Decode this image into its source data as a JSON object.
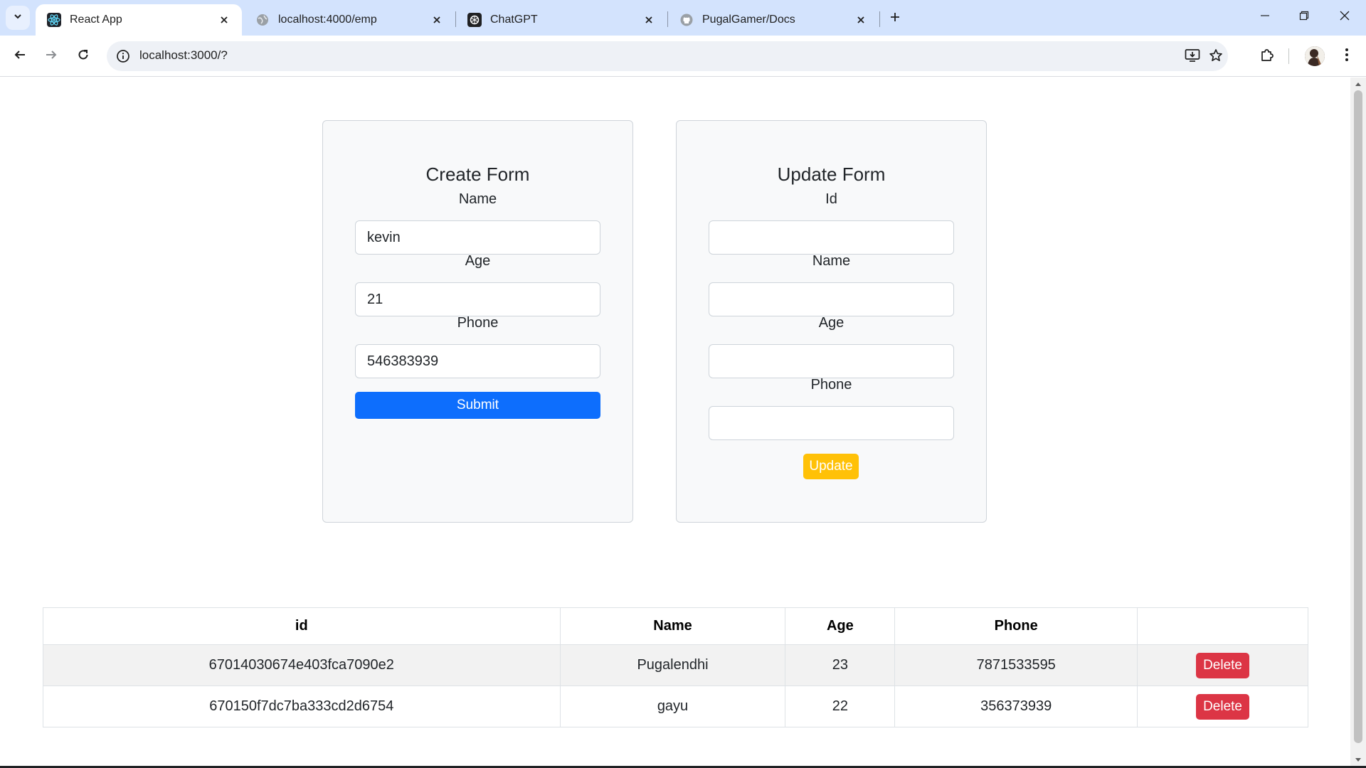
{
  "browser": {
    "tabs": [
      {
        "title": "React App",
        "icon": "react-icon",
        "active": true
      },
      {
        "title": "localhost:4000/emp",
        "icon": "globe-icon",
        "active": false
      },
      {
        "title": "ChatGPT",
        "icon": "chatgpt-icon",
        "active": false
      },
      {
        "title": "PugalGamer/Docs",
        "icon": "github-icon",
        "active": false
      }
    ],
    "url": "localhost:3000/?"
  },
  "create_form": {
    "title": "Create Form",
    "name_label": "Name",
    "name_value": "kevin",
    "age_label": "Age",
    "age_value": "21",
    "phone_label": "Phone",
    "phone_value": "546383939",
    "submit_label": "Submit",
    "submit_color": "#0d6efd"
  },
  "update_form": {
    "title": "Update Form",
    "id_label": "Id",
    "id_value": "",
    "name_label": "Name",
    "name_value": "",
    "age_label": "Age",
    "age_value": "",
    "phone_label": "Phone",
    "phone_value": "",
    "update_label": "Update",
    "update_color": "#ffc107"
  },
  "table": {
    "headers": [
      "id",
      "Name",
      "Age",
      "Phone",
      ""
    ],
    "rows": [
      {
        "id": "67014030674e403fca7090e2",
        "name": "Pugalendhi",
        "age": "23",
        "phone": "7871533595",
        "action": "Delete"
      },
      {
        "id": "670150f7dc7ba333cd2d6754",
        "name": "gayu",
        "age": "22",
        "phone": "356373939",
        "action": "Delete"
      }
    ],
    "delete_color": "#dc3545"
  }
}
